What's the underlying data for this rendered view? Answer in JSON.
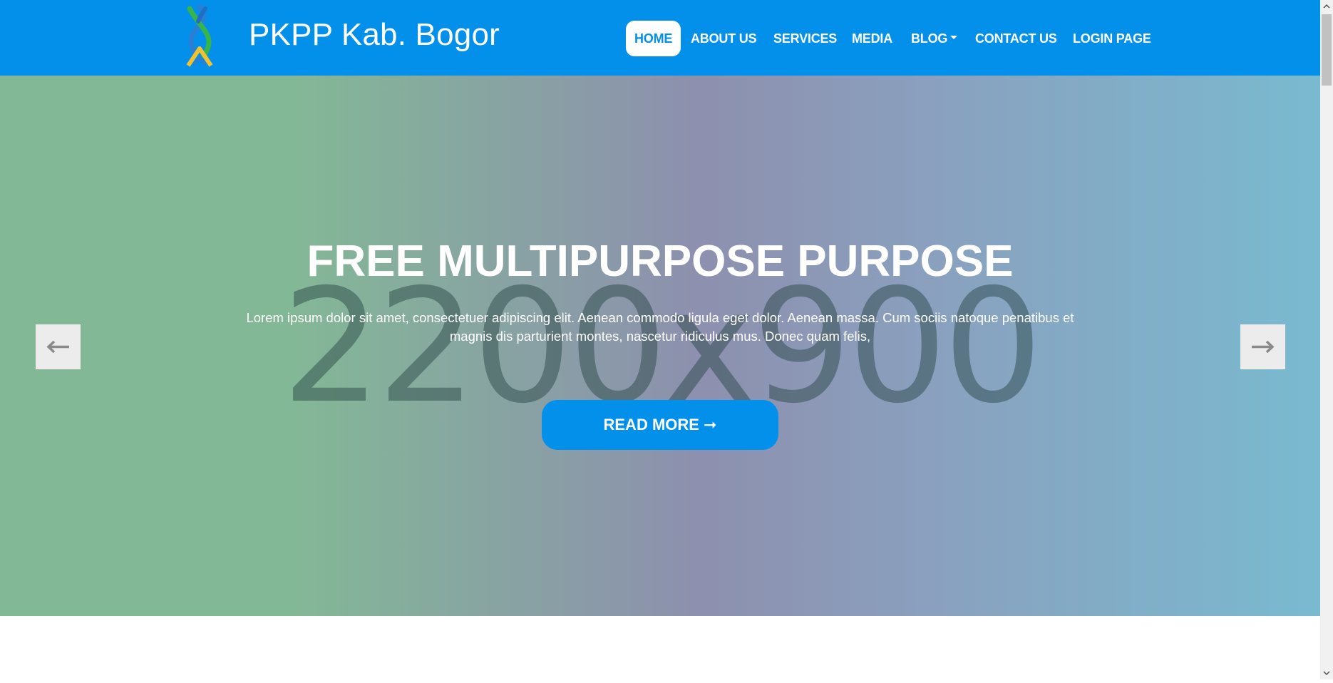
{
  "header": {
    "brand": "PKPP Kab. Bogor",
    "logo_icon": "pkpp-logo-icon"
  },
  "nav": [
    {
      "label": "HOME",
      "active": true
    },
    {
      "label": "ABOUT US"
    },
    {
      "label": "SERVICES"
    },
    {
      "label": "MEDIA"
    },
    {
      "label": "BLOG",
      "dropdown": true
    },
    {
      "label": "CONTACT US"
    },
    {
      "label": "LOGIN PAGE"
    }
  ],
  "hero": {
    "placeholder": "2200x900",
    "title": "FREE MULTIPURPOSE PURPOSE",
    "text": "Lorem ipsum dolor sit amet, consectetuer adipiscing elit. Aenean commodo ligula eget dolor. Aenean massa. Cum sociis natoque penatibus et magnis dis parturient montes, nascetur ridiculus mus. Donec quam felis,",
    "button": "READ MORE ➞",
    "prev_icon": "arrow-left-icon",
    "next_icon": "arrow-right-icon"
  },
  "colors": {
    "primary": "#0390eb",
    "white": "#ffffff"
  }
}
